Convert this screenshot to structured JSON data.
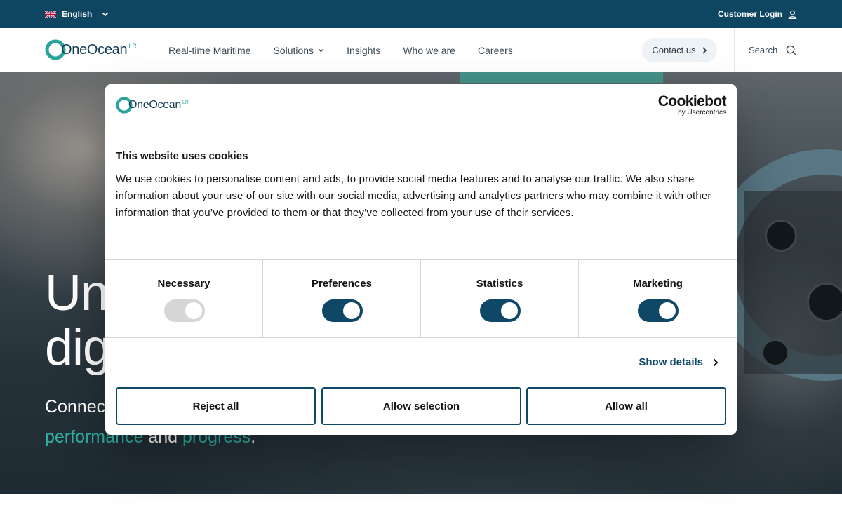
{
  "topbar": {
    "language": "English",
    "customer_login": "Customer Login"
  },
  "nav": {
    "brand": "OneOcean",
    "brand_sup": "LR",
    "items": [
      {
        "label": "Real-time Maritime",
        "dropdown": false
      },
      {
        "label": "Solutions",
        "dropdown": true
      },
      {
        "label": "Insights",
        "dropdown": false
      },
      {
        "label": "Who we are",
        "dropdown": false
      },
      {
        "label": "Careers",
        "dropdown": false
      }
    ],
    "contact": "Contact us",
    "search": "Search"
  },
  "hero": {
    "title_line1": "Un",
    "title_line2": "dig",
    "sub_line1": "Connec",
    "sub_accent1": "performance",
    "sub_mid": " and ",
    "sub_accent2": "progress",
    "sub_end": "."
  },
  "cookie_modal": {
    "logo_text": "OneOcean",
    "logo_sup": "LR",
    "provider_name": "Cookiebot",
    "provider_by": "by Usercentrics",
    "title": "This website uses cookies",
    "body": "We use cookies to personalise content and ads, to provide social media features and to analyse our traffic. We also share information about your use of our site with our social media, advertising and analytics partners who may combine it with other information that you’ve provided to them or that they’ve collected from your use of their services.",
    "categories": [
      {
        "label": "Necessary",
        "enabled": true,
        "locked": true
      },
      {
        "label": "Preferences",
        "enabled": true,
        "locked": false
      },
      {
        "label": "Statistics",
        "enabled": true,
        "locked": false
      },
      {
        "label": "Marketing",
        "enabled": true,
        "locked": false
      }
    ],
    "show_details": "Show details",
    "buttons": {
      "reject": "Reject all",
      "selection": "Allow selection",
      "allow_all": "Allow all"
    }
  },
  "colors": {
    "navy": "#0e4561",
    "teal": "#2fb1a4",
    "toggle_on": "#0f4766",
    "toggle_disabled": "#d6d6d6"
  }
}
